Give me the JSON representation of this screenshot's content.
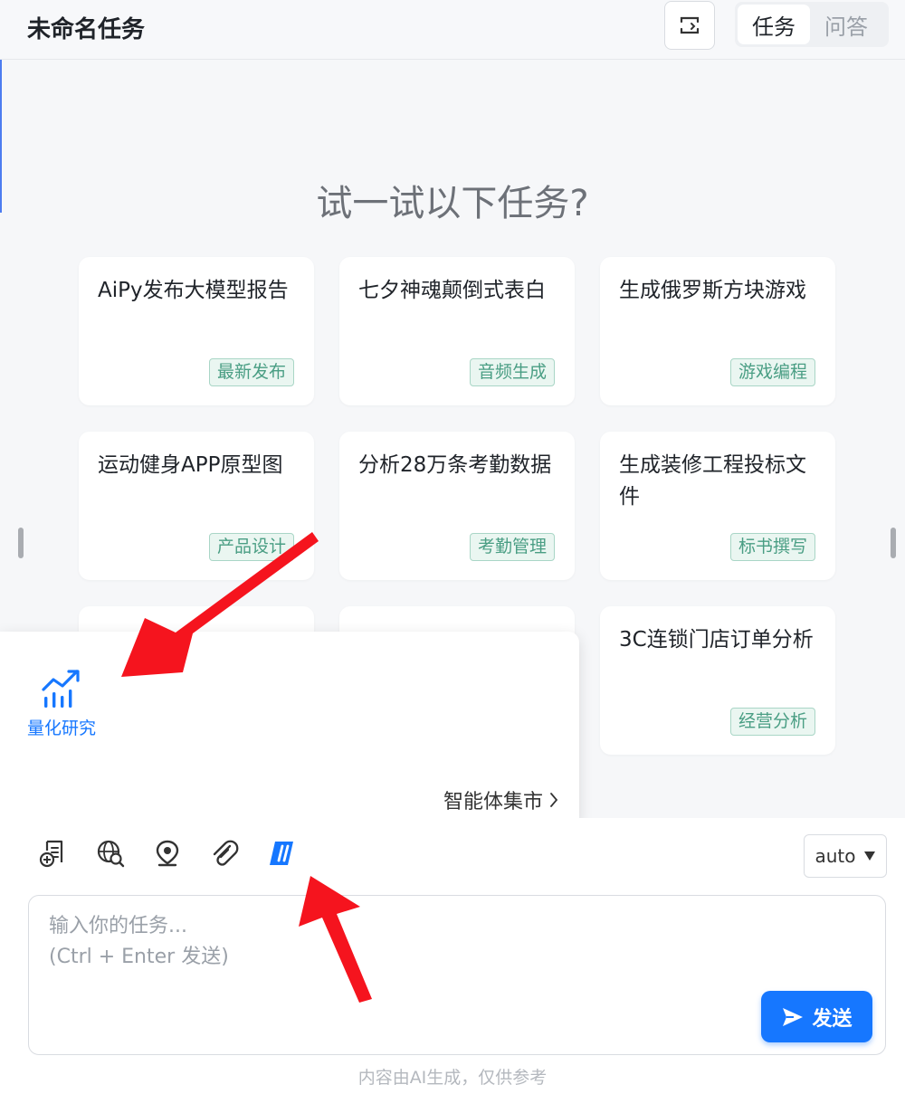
{
  "header": {
    "title": "未命名任务",
    "tabs": [
      {
        "label": "任务",
        "active": true
      },
      {
        "label": "问答",
        "active": false
      }
    ]
  },
  "main": {
    "prompt": "试一试以下任务?",
    "cards": [
      {
        "text": "AiPy发布大模型报告",
        "tag": "最新发布"
      },
      {
        "text": "七夕神魂颠倒式表白",
        "tag": "音频生成"
      },
      {
        "text": "生成俄罗斯方块游戏",
        "tag": "游戏编程"
      },
      {
        "text": "运动健身APP原型图",
        "tag": "产品设计"
      },
      {
        "text": "分析28万条考勤数据",
        "tag": "考勤管理"
      },
      {
        "text": "生成装修工程投标文件",
        "tag": "标书撰写"
      },
      {
        "text": "3C连锁门店订单分析",
        "tag": "经营分析"
      }
    ]
  },
  "popup": {
    "agent_label": "量化研究",
    "market_link": "智能体集市"
  },
  "input": {
    "model_select": "auto",
    "placeholder": "输入你的任务...\n(Ctrl + Enter 发送)",
    "send_label": "发送",
    "disclaimer": "内容由AI生成，仅供参考"
  },
  "icons": [
    "screen-toggle-icon",
    "new-document-icon",
    "web-search-icon",
    "location-icon",
    "attachment-icon",
    "agent-market-icon",
    "quant-chart-icon",
    "chevron-right-icon",
    "dropdown-triangle-icon",
    "send-arrow-icon"
  ],
  "colors": {
    "accent": "#1677ff",
    "tag_green": "#4a9e84",
    "annotation_red": "#f5141e"
  }
}
